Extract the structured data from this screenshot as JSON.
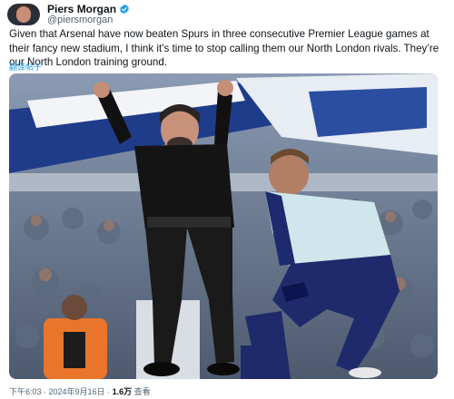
{
  "author": {
    "display_name": "Piers Morgan",
    "handle": "@piersmorgan",
    "verified": true,
    "verified_color": "#1d9bf0"
  },
  "tweet": {
    "text": "Given that Arsenal have now beaten Spurs in three consecutive Premier League games at their fancy new stadium, I think it’s time to stop calling them our North London rivals. They’re our North London training ground.",
    "translate_label": "翻译帖子"
  },
  "footer": {
    "time": "下午6:03",
    "separator": " · ",
    "date": "2024年9月16日",
    "views_count": "1.6万",
    "views_label": "查看"
  },
  "colors": {
    "link": "#1d9bf0",
    "secondary_text": "#536471"
  },
  "icons": [
    "verified-badge-icon"
  ]
}
